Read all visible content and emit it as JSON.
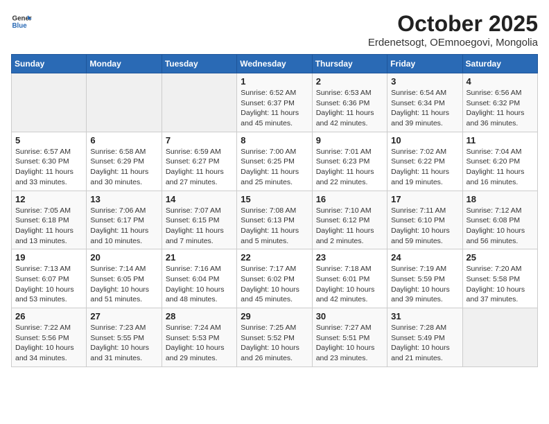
{
  "header": {
    "logo_line1": "General",
    "logo_line2": "Blue",
    "title": "October 2025",
    "subtitle": "Erdenetsogt, OEmnoegovi, Mongolia"
  },
  "days_of_week": [
    "Sunday",
    "Monday",
    "Tuesday",
    "Wednesday",
    "Thursday",
    "Friday",
    "Saturday"
  ],
  "weeks": [
    [
      {
        "day": "",
        "info": ""
      },
      {
        "day": "",
        "info": ""
      },
      {
        "day": "",
        "info": ""
      },
      {
        "day": "1",
        "info": "Sunrise: 6:52 AM\nSunset: 6:37 PM\nDaylight: 11 hours\nand 45 minutes."
      },
      {
        "day": "2",
        "info": "Sunrise: 6:53 AM\nSunset: 6:36 PM\nDaylight: 11 hours\nand 42 minutes."
      },
      {
        "day": "3",
        "info": "Sunrise: 6:54 AM\nSunset: 6:34 PM\nDaylight: 11 hours\nand 39 minutes."
      },
      {
        "day": "4",
        "info": "Sunrise: 6:56 AM\nSunset: 6:32 PM\nDaylight: 11 hours\nand 36 minutes."
      }
    ],
    [
      {
        "day": "5",
        "info": "Sunrise: 6:57 AM\nSunset: 6:30 PM\nDaylight: 11 hours\nand 33 minutes."
      },
      {
        "day": "6",
        "info": "Sunrise: 6:58 AM\nSunset: 6:29 PM\nDaylight: 11 hours\nand 30 minutes."
      },
      {
        "day": "7",
        "info": "Sunrise: 6:59 AM\nSunset: 6:27 PM\nDaylight: 11 hours\nand 27 minutes."
      },
      {
        "day": "8",
        "info": "Sunrise: 7:00 AM\nSunset: 6:25 PM\nDaylight: 11 hours\nand 25 minutes."
      },
      {
        "day": "9",
        "info": "Sunrise: 7:01 AM\nSunset: 6:23 PM\nDaylight: 11 hours\nand 22 minutes."
      },
      {
        "day": "10",
        "info": "Sunrise: 7:02 AM\nSunset: 6:22 PM\nDaylight: 11 hours\nand 19 minutes."
      },
      {
        "day": "11",
        "info": "Sunrise: 7:04 AM\nSunset: 6:20 PM\nDaylight: 11 hours\nand 16 minutes."
      }
    ],
    [
      {
        "day": "12",
        "info": "Sunrise: 7:05 AM\nSunset: 6:18 PM\nDaylight: 11 hours\nand 13 minutes."
      },
      {
        "day": "13",
        "info": "Sunrise: 7:06 AM\nSunset: 6:17 PM\nDaylight: 11 hours\nand 10 minutes."
      },
      {
        "day": "14",
        "info": "Sunrise: 7:07 AM\nSunset: 6:15 PM\nDaylight: 11 hours\nand 7 minutes."
      },
      {
        "day": "15",
        "info": "Sunrise: 7:08 AM\nSunset: 6:13 PM\nDaylight: 11 hours\nand 5 minutes."
      },
      {
        "day": "16",
        "info": "Sunrise: 7:10 AM\nSunset: 6:12 PM\nDaylight: 11 hours\nand 2 minutes."
      },
      {
        "day": "17",
        "info": "Sunrise: 7:11 AM\nSunset: 6:10 PM\nDaylight: 10 hours\nand 59 minutes."
      },
      {
        "day": "18",
        "info": "Sunrise: 7:12 AM\nSunset: 6:08 PM\nDaylight: 10 hours\nand 56 minutes."
      }
    ],
    [
      {
        "day": "19",
        "info": "Sunrise: 7:13 AM\nSunset: 6:07 PM\nDaylight: 10 hours\nand 53 minutes."
      },
      {
        "day": "20",
        "info": "Sunrise: 7:14 AM\nSunset: 6:05 PM\nDaylight: 10 hours\nand 51 minutes."
      },
      {
        "day": "21",
        "info": "Sunrise: 7:16 AM\nSunset: 6:04 PM\nDaylight: 10 hours\nand 48 minutes."
      },
      {
        "day": "22",
        "info": "Sunrise: 7:17 AM\nSunset: 6:02 PM\nDaylight: 10 hours\nand 45 minutes."
      },
      {
        "day": "23",
        "info": "Sunrise: 7:18 AM\nSunset: 6:01 PM\nDaylight: 10 hours\nand 42 minutes."
      },
      {
        "day": "24",
        "info": "Sunrise: 7:19 AM\nSunset: 5:59 PM\nDaylight: 10 hours\nand 39 minutes."
      },
      {
        "day": "25",
        "info": "Sunrise: 7:20 AM\nSunset: 5:58 PM\nDaylight: 10 hours\nand 37 minutes."
      }
    ],
    [
      {
        "day": "26",
        "info": "Sunrise: 7:22 AM\nSunset: 5:56 PM\nDaylight: 10 hours\nand 34 minutes."
      },
      {
        "day": "27",
        "info": "Sunrise: 7:23 AM\nSunset: 5:55 PM\nDaylight: 10 hours\nand 31 minutes."
      },
      {
        "day": "28",
        "info": "Sunrise: 7:24 AM\nSunset: 5:53 PM\nDaylight: 10 hours\nand 29 minutes."
      },
      {
        "day": "29",
        "info": "Sunrise: 7:25 AM\nSunset: 5:52 PM\nDaylight: 10 hours\nand 26 minutes."
      },
      {
        "day": "30",
        "info": "Sunrise: 7:27 AM\nSunset: 5:51 PM\nDaylight: 10 hours\nand 23 minutes."
      },
      {
        "day": "31",
        "info": "Sunrise: 7:28 AM\nSunset: 5:49 PM\nDaylight: 10 hours\nand 21 minutes."
      },
      {
        "day": "",
        "info": ""
      }
    ]
  ]
}
